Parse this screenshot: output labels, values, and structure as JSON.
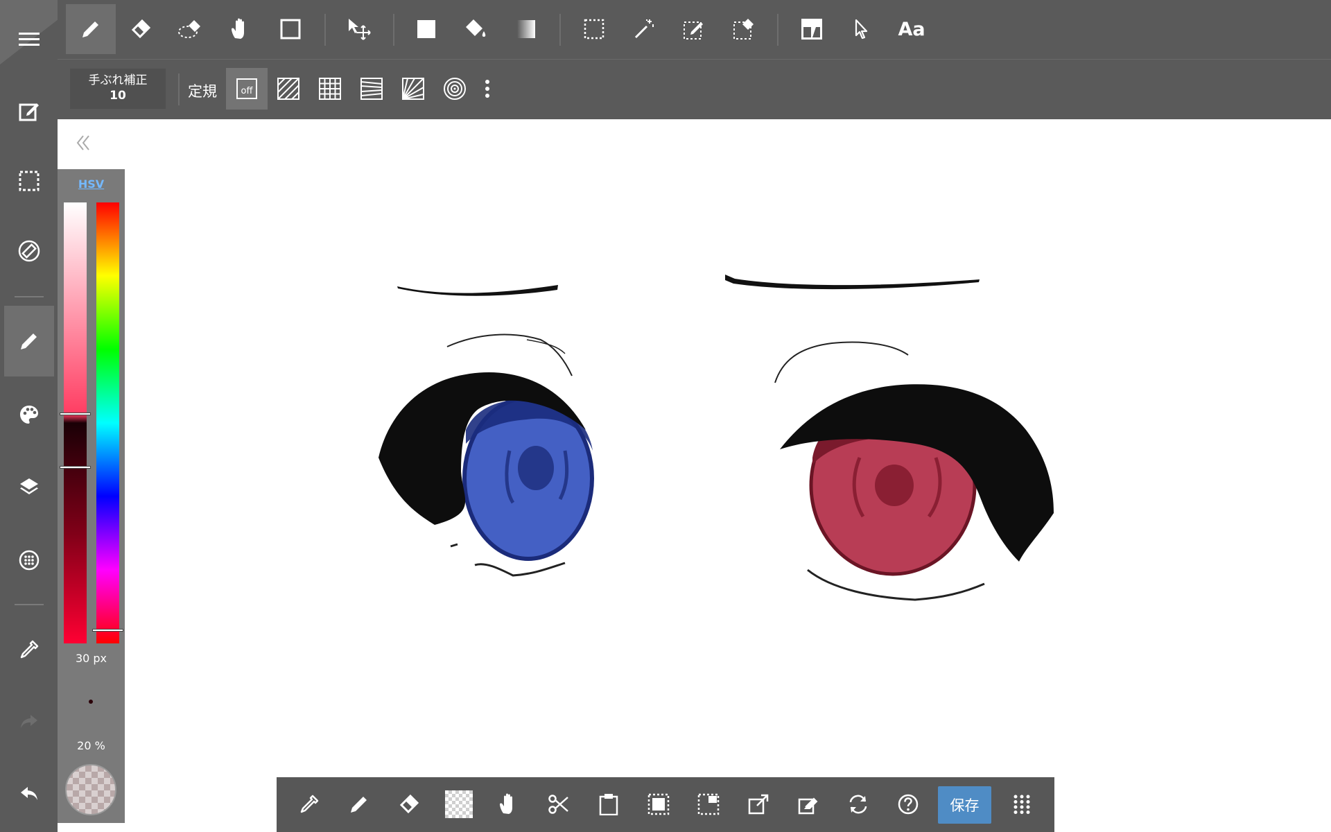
{
  "stabilizer": {
    "label": "手ぶれ補正",
    "value": "10"
  },
  "ruler": {
    "label": "定規",
    "off_label": "off"
  },
  "color_panel": {
    "mode_tab": "HSV",
    "brush_size": "30 px",
    "opacity": "20 %",
    "hue_level": 0.97,
    "saturation_level": 0.48,
    "brightness_level": 0.6
  },
  "bottom_bar": {
    "save_label": "保存"
  },
  "colors": {
    "toolbar_bg": "#5a5a5a",
    "panel_bg": "#7a7a7a",
    "save_button": "#4f8cc5",
    "left_iris": "#4460c4",
    "right_iris": "#b83d55",
    "hsv_tab": "#74b9ff"
  },
  "toolbar_icons": [
    "pen-icon",
    "eraser-icon",
    "lasso-eraser-icon",
    "hand-icon",
    "rectangle-icon",
    "move-icon",
    "fill-square-icon",
    "bucket-icon",
    "gradient-icon",
    "select-rect-icon",
    "magic-wand-icon",
    "select-pen-icon",
    "select-eraser-icon",
    "frame-icon",
    "pointer-icon",
    "text-icon"
  ],
  "toolbar_text_tool": "Aa"
}
